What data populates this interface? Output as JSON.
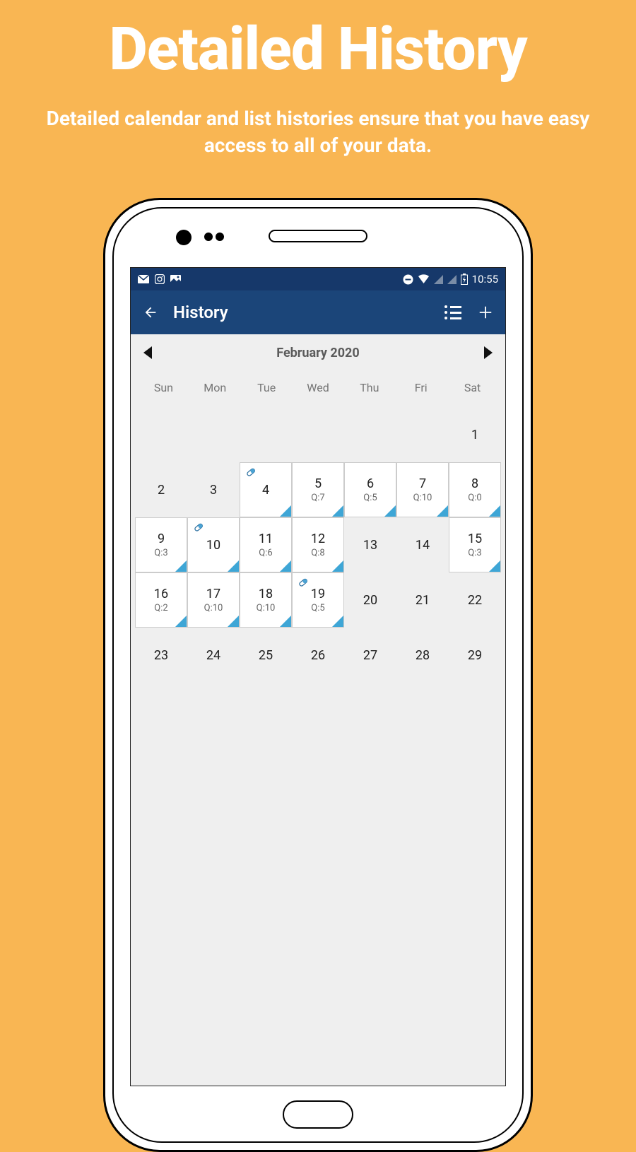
{
  "hero": {
    "title": "Detailed History",
    "subtitle": "Detailed calendar and list histories ensure that you have easy access to all of your data."
  },
  "statusbar": {
    "time": "10:55"
  },
  "appbar": {
    "title": "History"
  },
  "calendar": {
    "month_label": "February 2020",
    "weekdays": [
      "Sun",
      "Mon",
      "Tue",
      "Wed",
      "Thu",
      "Fri",
      "Sat"
    ],
    "cells": [
      {
        "day": "",
        "data": false
      },
      {
        "day": "",
        "data": false
      },
      {
        "day": "",
        "data": false
      },
      {
        "day": "",
        "data": false
      },
      {
        "day": "",
        "data": false
      },
      {
        "day": "",
        "data": false
      },
      {
        "day": "1",
        "data": false
      },
      {
        "day": "2",
        "data": false
      },
      {
        "day": "3",
        "data": false
      },
      {
        "day": "4",
        "data": true,
        "pill": true
      },
      {
        "day": "5",
        "data": true,
        "q": "Q:7"
      },
      {
        "day": "6",
        "data": true,
        "q": "Q:5"
      },
      {
        "day": "7",
        "data": true,
        "q": "Q:10"
      },
      {
        "day": "8",
        "data": true,
        "q": "Q:0"
      },
      {
        "day": "9",
        "data": true,
        "q": "Q:3"
      },
      {
        "day": "10",
        "data": true,
        "pill": true
      },
      {
        "day": "11",
        "data": true,
        "q": "Q:6"
      },
      {
        "day": "12",
        "data": true,
        "q": "Q:8"
      },
      {
        "day": "13",
        "data": false
      },
      {
        "day": "14",
        "data": false
      },
      {
        "day": "15",
        "data": true,
        "q": "Q:3"
      },
      {
        "day": "16",
        "data": true,
        "q": "Q:2"
      },
      {
        "day": "17",
        "data": true,
        "q": "Q:10"
      },
      {
        "day": "18",
        "data": true,
        "q": "Q:10"
      },
      {
        "day": "19",
        "data": true,
        "q": "Q:5",
        "pill": true
      },
      {
        "day": "20",
        "data": false
      },
      {
        "day": "21",
        "data": false
      },
      {
        "day": "22",
        "data": false
      },
      {
        "day": "23",
        "data": false
      },
      {
        "day": "24",
        "data": false
      },
      {
        "day": "25",
        "data": false
      },
      {
        "day": "26",
        "data": false
      },
      {
        "day": "27",
        "data": false
      },
      {
        "day": "28",
        "data": false
      },
      {
        "day": "29",
        "data": false
      }
    ]
  }
}
